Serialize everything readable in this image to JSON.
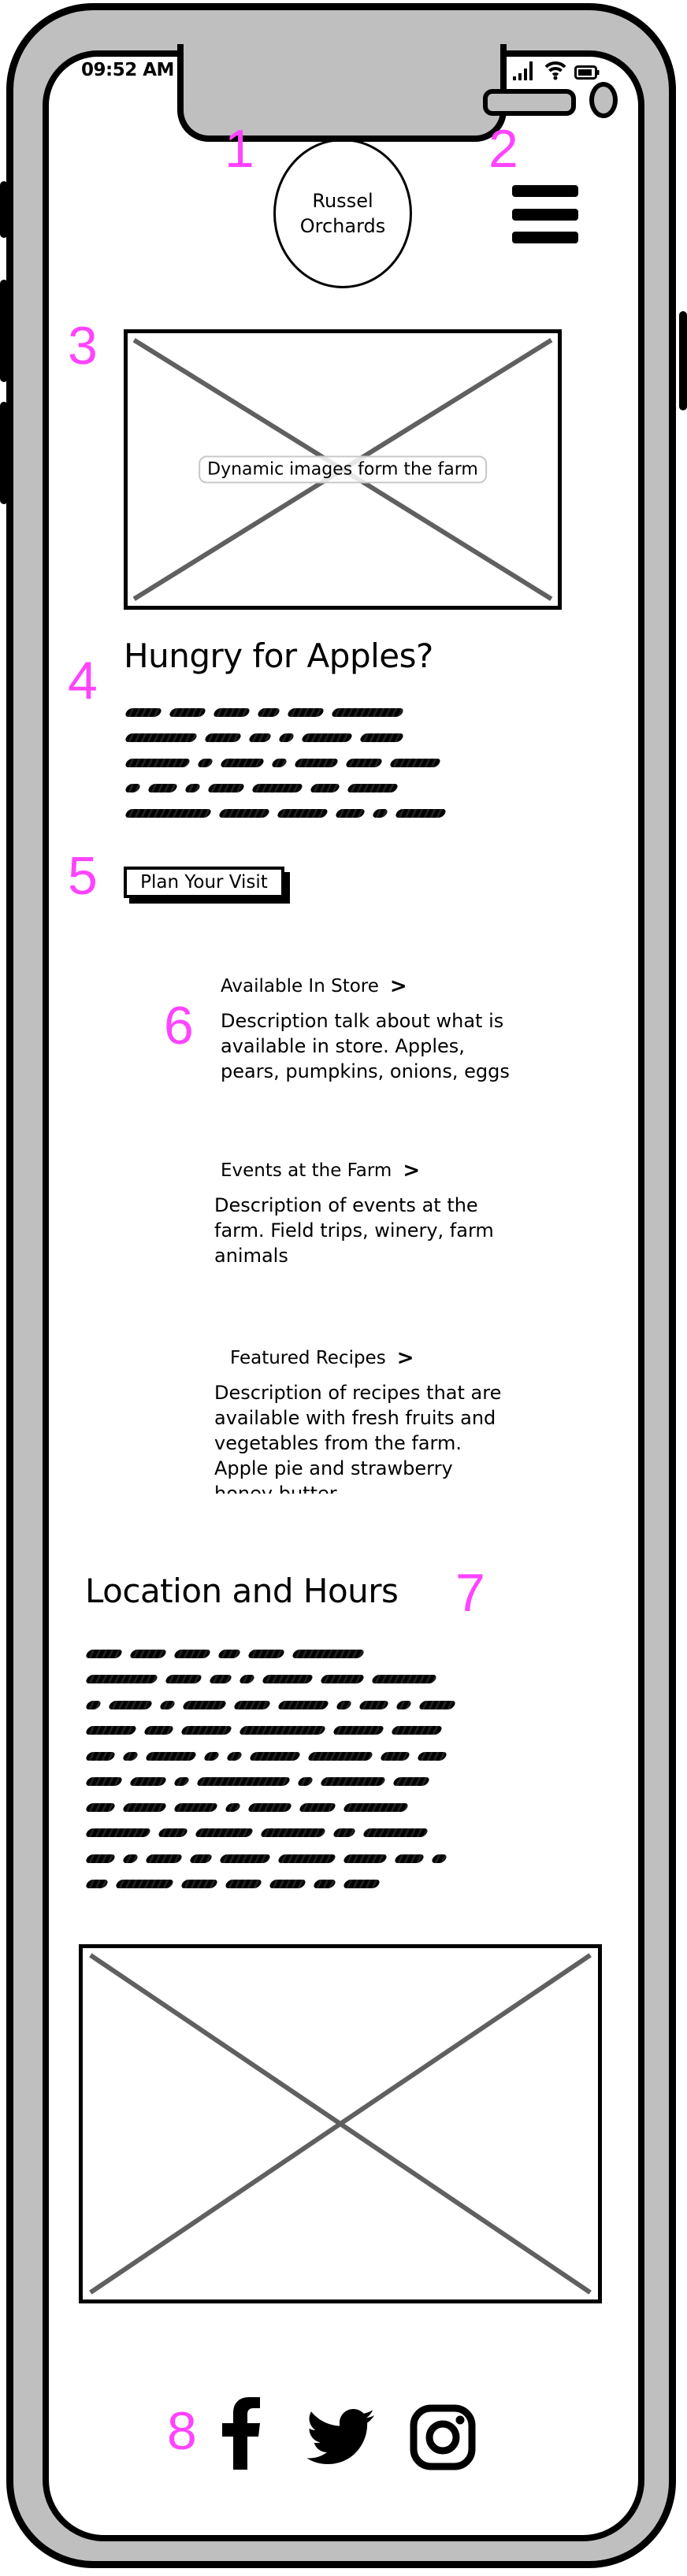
{
  "status_bar": {
    "time": "09:52 AM",
    "icons": [
      "signal-icon",
      "wifi-icon",
      "battery-icon"
    ]
  },
  "annotations": [
    "1",
    "2",
    "3",
    "4",
    "5",
    "6",
    "7",
    "8"
  ],
  "header": {
    "logo_line1": "Russel",
    "logo_line2": "Orchards",
    "menu_icon": "hamburger-menu-icon"
  },
  "hero": {
    "image_caption": "Dynamic images form the farm"
  },
  "intro": {
    "heading": "Hungry for Apples?",
    "body_placeholder_lines": [
      [
        4,
        4,
        4,
        2,
        4,
        9
      ],
      [
        9,
        4,
        2,
        1,
        6,
        5
      ],
      [
        8,
        1,
        5,
        1,
        5,
        4,
        6
      ],
      [
        1,
        3,
        1,
        4,
        6,
        3,
        6
      ],
      [
        11,
        6,
        6,
        3,
        1,
        6
      ]
    ]
  },
  "cta": {
    "label": "Plan Your Visit"
  },
  "cards": [
    {
      "title": "Available In Store",
      "chevron": ">",
      "description": "Description talk about what is available in store. Apples, pears, pumpkins, onions, eggs"
    },
    {
      "title": "Events at the Farm",
      "chevron": ">",
      "description": "Description of events at the farm. Field trips, winery, farm animals"
    },
    {
      "title": "Featured Recipes",
      "chevron": ">",
      "description": "Description of recipes that are available with fresh fruits and vegetables from the farm. Apple pie and strawberry honey butter"
    }
  ],
  "location": {
    "heading": "Location and Hours",
    "body_placeholder_lines": [
      [
        4,
        4,
        4,
        2,
        4,
        9
      ],
      [
        9,
        4,
        2,
        1,
        6,
        5,
        8
      ],
      [
        1,
        5,
        1,
        5,
        4,
        6,
        1,
        3,
        1,
        4
      ],
      [
        6,
        3,
        6,
        11,
        6,
        6
      ],
      [
        3,
        1,
        6,
        1,
        1,
        6,
        8,
        3,
        3
      ],
      [
        4,
        4,
        1,
        12,
        1,
        8,
        4
      ],
      [
        3,
        5,
        5,
        1,
        5,
        4,
        8
      ],
      [
        8,
        3,
        7,
        8,
        2,
        8
      ],
      [
        3,
        1,
        4,
        2,
        6,
        7,
        5,
        3,
        1
      ],
      [
        2,
        7,
        4,
        4,
        4,
        2,
        4
      ]
    ]
  },
  "social": [
    "facebook-icon",
    "twitter-icon",
    "instagram-icon"
  ],
  "colors": {
    "annotation": "#ff44ff",
    "frame": "#bfbfbf",
    "placeholder_cross": "#606060"
  }
}
